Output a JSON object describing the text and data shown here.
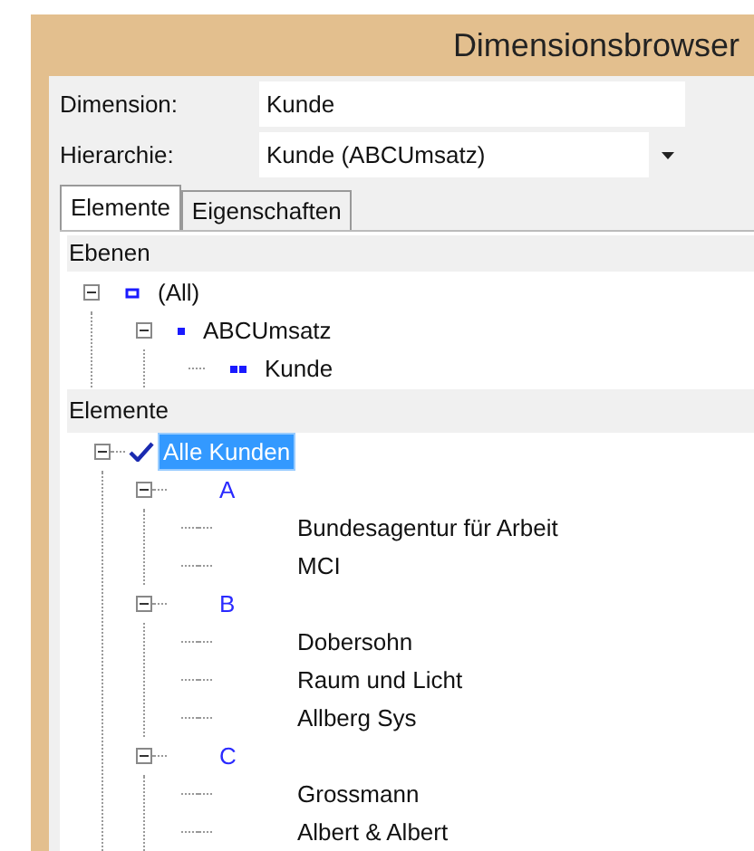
{
  "window": {
    "title": "Dimensionsbrowser"
  },
  "fields": [
    {
      "label": "Dimension:",
      "value": "Kunde",
      "kind": "text"
    },
    {
      "label": "Hierarchie:",
      "value": "Kunde (ABCUmsatz)",
      "kind": "dropdown"
    }
  ],
  "tabs": [
    {
      "label": "Elemente",
      "selected": true
    },
    {
      "label": "Eigenschaften",
      "selected": false
    }
  ],
  "levels": {
    "header": "Ebenen",
    "items": [
      {
        "label": "(All)",
        "expanded": true,
        "children": [
          {
            "label": "ABCUmsatz",
            "expanded": true,
            "children": [
              {
                "label": "Kunde"
              }
            ]
          }
        ]
      }
    ]
  },
  "elements": {
    "header": "Elemente",
    "items": [
      {
        "label": "Alle Kunden",
        "expanded": true,
        "checked": true,
        "selected": true,
        "children": [
          {
            "label": "A",
            "kind": "group",
            "expanded": true,
            "selected": false,
            "children": [
              {
                "label": "Bundesagentur für Arbeit",
                "kind": "member",
                "selected": false
              },
              {
                "label": "MCI",
                "kind": "member",
                "selected": false
              }
            ]
          },
          {
            "label": "B",
            "kind": "group",
            "expanded": true,
            "selected": false,
            "children": [
              {
                "label": "Dobersohn",
                "kind": "member",
                "selected": false
              },
              {
                "label": "Raum und Licht",
                "kind": "member",
                "selected": false
              },
              {
                "label": "Allberg Sys",
                "kind": "member",
                "selected": false
              }
            ]
          },
          {
            "label": "C",
            "kind": "group",
            "expanded": true,
            "selected": false,
            "children": [
              {
                "label": "Grossmann",
                "kind": "member",
                "selected": false
              },
              {
                "label": "Albert & Albert",
                "kind": "member",
                "selected": false
              }
            ]
          }
        ]
      }
    ]
  }
}
